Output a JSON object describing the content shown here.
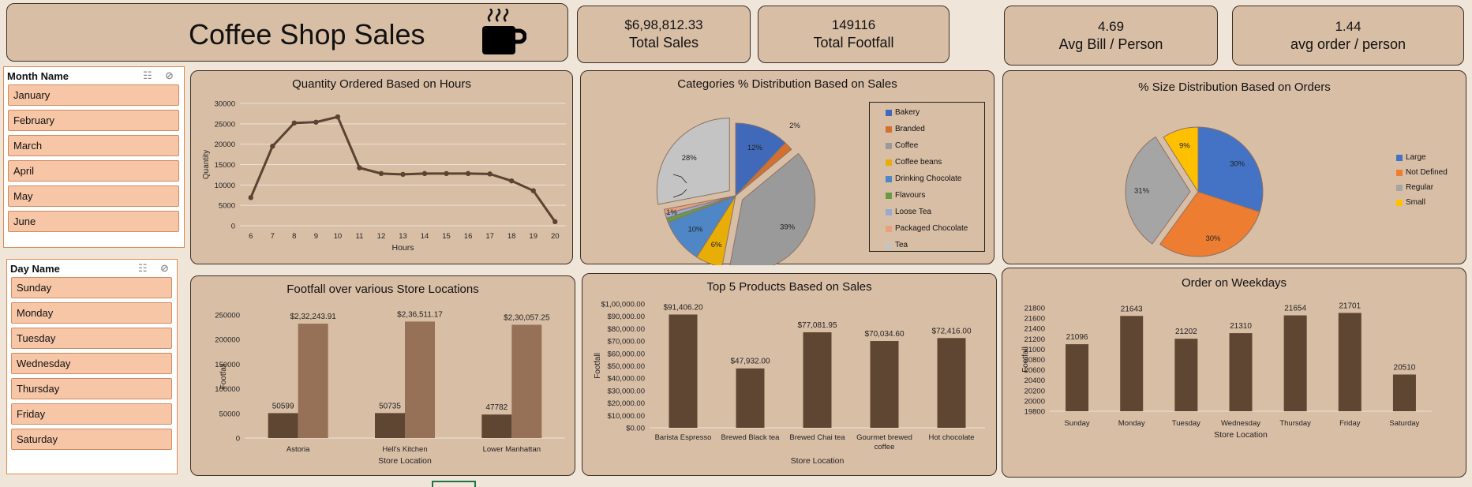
{
  "header": {
    "title": "Coffee Shop Sales",
    "icon": "coffee-cup-icon"
  },
  "kpis": [
    {
      "value": "$6,98,812.33",
      "label": "Total Sales"
    },
    {
      "value": "149116",
      "label": "Total Footfall"
    },
    {
      "value": "4.69",
      "label": "Avg Bill / Person"
    },
    {
      "value": "1.44",
      "label": "avg order / person"
    }
  ],
  "month_slicer": {
    "title": "Month Name",
    "items": [
      "January",
      "February",
      "March",
      "April",
      "May",
      "June"
    ]
  },
  "day_slicer": {
    "title": "Day Name",
    "items": [
      "Sunday",
      "Monday",
      "Tuesday",
      "Wednesday",
      "Thursday",
      "Friday",
      "Saturday"
    ]
  },
  "colors": {
    "bar": "#5e4632",
    "bar2": "#967157",
    "line": "#5b4332",
    "panel": "#d9bea6"
  },
  "chart_data": [
    {
      "id": "hours",
      "type": "line",
      "title": "Quantity Ordered Based on Hours",
      "xlabel": "Hours",
      "ylabel": "Quantity",
      "x": [
        6,
        7,
        8,
        9,
        10,
        11,
        12,
        13,
        14,
        15,
        16,
        17,
        18,
        19,
        20
      ],
      "values": [
        6900,
        19500,
        25200,
        25400,
        26700,
        14200,
        12800,
        12600,
        12800,
        12800,
        12800,
        12700,
        11000,
        8600,
        1000
      ],
      "ylim": [
        0,
        30000
      ],
      "yticks": [
        0,
        5000,
        10000,
        15000,
        20000,
        25000,
        30000
      ],
      "yticklabels": [
        "0",
        "5000",
        "10000",
        "15000",
        "20000",
        "25000",
        "30000"
      ],
      "grid": true
    },
    {
      "id": "categories",
      "type": "pie",
      "title": "Categories % Distribution Based on Sales",
      "labels": [
        "Bakery",
        "Branded",
        "Coffee",
        "Coffee beans",
        "Drinking Chocolate",
        "Flavours",
        "Loose Tea",
        "Packaged Chocolate",
        "Tea"
      ],
      "values": [
        12,
        2,
        39,
        6,
        10,
        1,
        1,
        1,
        28
      ],
      "value_labels": [
        "12%",
        "2%",
        "39%",
        "6%",
        "10%",
        "1%",
        "1%",
        "1%",
        "28%"
      ],
      "colors": [
        "#4169b9",
        "#d4702f",
        "#9a9a9a",
        "#e9ad08",
        "#4f87c6",
        "#6a9a43",
        "#9aa9cf",
        "#e9a07f",
        "#c4c4c4"
      ],
      "legend": "right"
    },
    {
      "id": "sizes",
      "type": "pie",
      "title": "% Size Distribution Based on Orders",
      "labels": [
        "Large",
        "Not Defined",
        "Regular",
        "Small"
      ],
      "values": [
        30,
        30,
        31,
        9
      ],
      "value_labels": [
        "30%",
        "30%",
        "31%",
        "9%"
      ],
      "colors": [
        "#4472c4",
        "#ed7d31",
        "#a5a5a5",
        "#ffc000"
      ],
      "legend": "right"
    },
    {
      "id": "locations",
      "type": "bar",
      "title": "Footfall over various Store Locations",
      "xlabel": "Store Location",
      "ylabel": "Footfall",
      "categories": [
        "Astoria",
        "Hell's Kitchen",
        "Lower Manhattan"
      ],
      "series": [
        {
          "values": [
            50599,
            50735,
            47782
          ],
          "value_labels": [
            "50599",
            "50735",
            "47782"
          ]
        },
        {
          "values": [
            232243.91,
            236511.17,
            230057.25
          ],
          "value_labels": [
            "$2,32,243.91",
            "$2,36,511.17",
            "$2,30,057.25"
          ]
        }
      ],
      "ylim": [
        0,
        250000
      ],
      "yticks": [
        0,
        50000,
        100000,
        150000,
        200000,
        250000
      ],
      "yticklabels": [
        "0",
        "50000",
        "100000",
        "150000",
        "200000",
        "250000"
      ]
    },
    {
      "id": "products",
      "type": "bar",
      "title": "Top 5 Products Based on Sales",
      "xlabel": "Store Location",
      "ylabel": "Footfall",
      "categories": [
        "Barista Espresso",
        "Brewed Black tea",
        "Brewed Chai tea",
        "Gourmet brewed coffee",
        "Hot chocolate"
      ],
      "values": [
        91406.2,
        47932.0,
        77081.95,
        70034.6,
        72416.0
      ],
      "value_labels": [
        "$91,406.20",
        "$47,932.00",
        "$77,081.95",
        "$70,034.60",
        "$72,416.00"
      ],
      "ylim": [
        0,
        100000
      ],
      "yticks": [
        0,
        10000,
        20000,
        30000,
        40000,
        50000,
        60000,
        70000,
        80000,
        90000,
        100000
      ],
      "yticklabels": [
        "$0.00",
        "$10,000.00",
        "$20,000.00",
        "$30,000.00",
        "$40,000.00",
        "$50,000.00",
        "$60,000.00",
        "$70,000.00",
        "$80,000.00",
        "$90,000.00",
        "$1,00,000.00"
      ]
    },
    {
      "id": "weekdays",
      "type": "bar",
      "title": "Order on Weekdays",
      "xlabel": "Store Location",
      "ylabel": "Footfall",
      "categories": [
        "Sunday",
        "Monday",
        "Tuesday",
        "Wednesday",
        "Thursday",
        "Friday",
        "Saturday"
      ],
      "values": [
        21096,
        21643,
        21202,
        21310,
        21654,
        21701,
        20510
      ],
      "value_labels": [
        "21096",
        "21643",
        "21202",
        "21310",
        "21654",
        "21701",
        "20510"
      ],
      "ylim": [
        19800,
        21800
      ],
      "yticks": [
        19800,
        20000,
        20200,
        20400,
        20600,
        20800,
        21000,
        21200,
        21400,
        21600,
        21800
      ],
      "yticklabels": [
        "19800",
        "20000",
        "20200",
        "20400",
        "20600",
        "20800",
        "21000",
        "21200",
        "21400",
        "21600",
        "21800"
      ]
    }
  ]
}
